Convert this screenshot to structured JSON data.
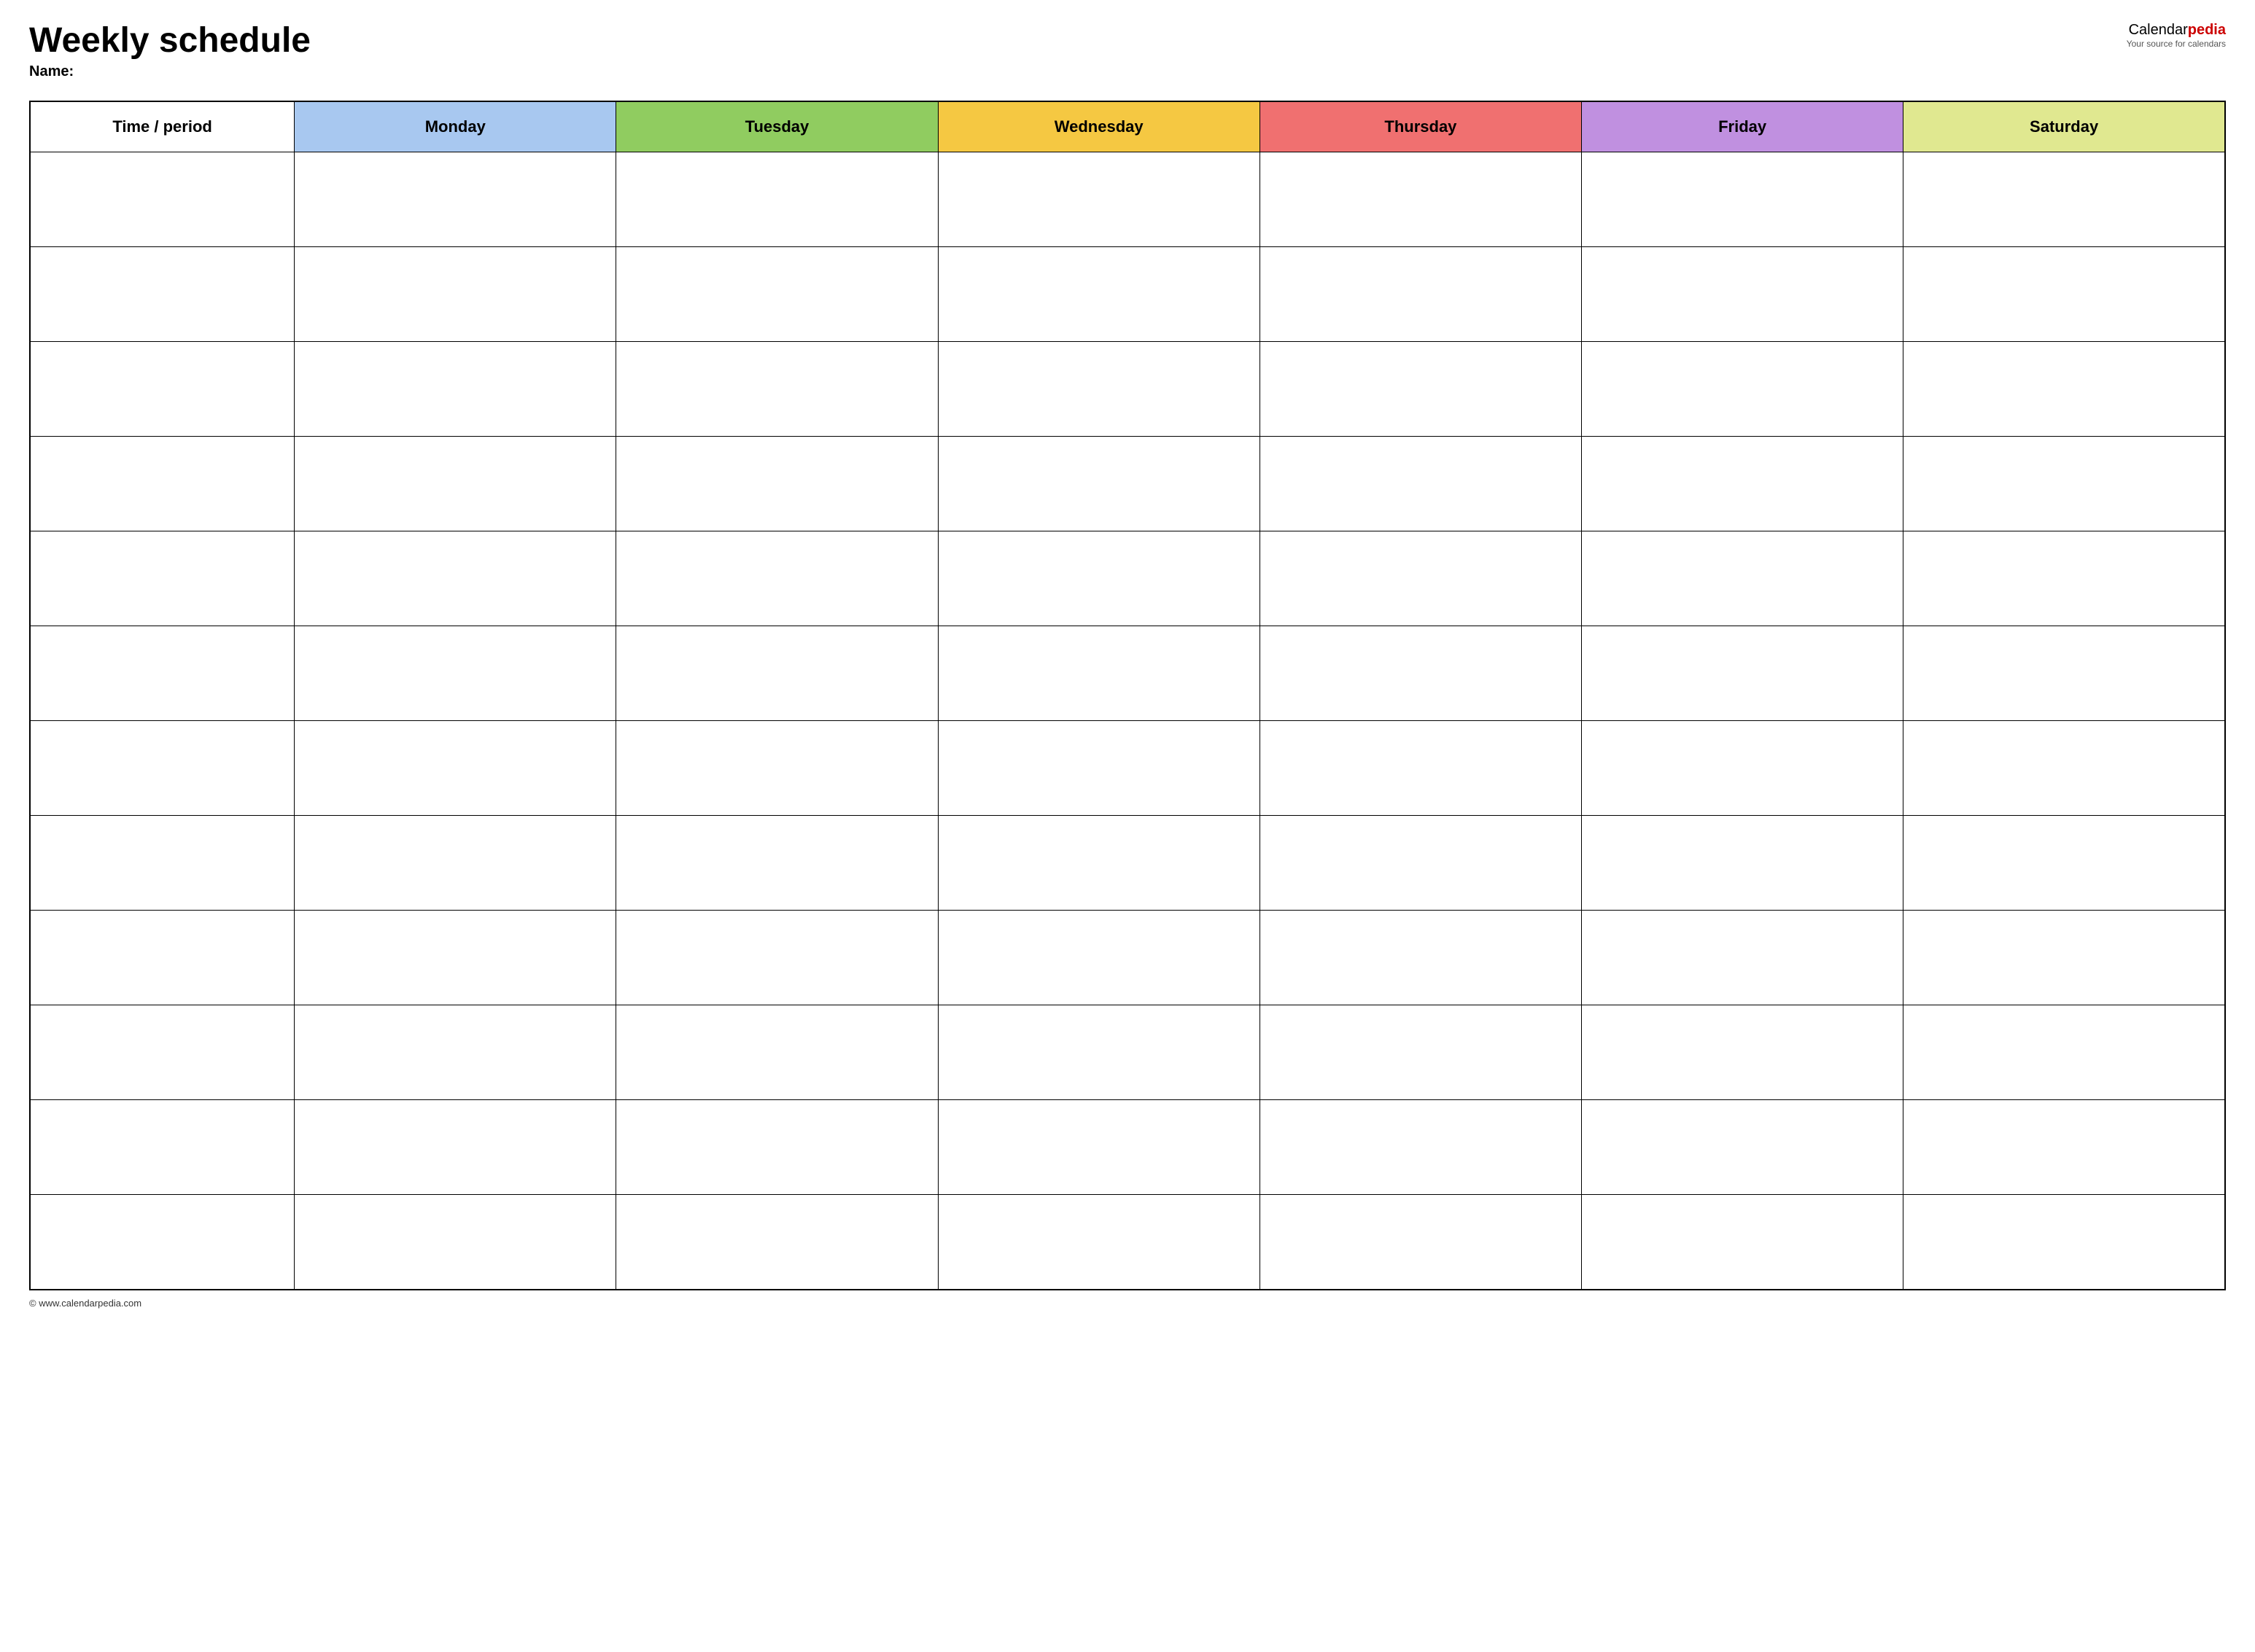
{
  "header": {
    "title": "Weekly schedule",
    "name_label": "Name:",
    "brand": {
      "name_part1": "Calendar",
      "name_part2": "pedia",
      "tagline": "Your source for calendars"
    }
  },
  "table": {
    "columns": [
      {
        "id": "time",
        "label": "Time / period",
        "color": "#ffffff"
      },
      {
        "id": "monday",
        "label": "Monday",
        "color": "#a8c8f0"
      },
      {
        "id": "tuesday",
        "label": "Tuesday",
        "color": "#90cc60"
      },
      {
        "id": "wednesday",
        "label": "Wednesday",
        "color": "#f5c842"
      },
      {
        "id": "thursday",
        "label": "Thursday",
        "color": "#f07070"
      },
      {
        "id": "friday",
        "label": "Friday",
        "color": "#c090e0"
      },
      {
        "id": "saturday",
        "label": "Saturday",
        "color": "#e0e890"
      }
    ],
    "row_count": 12
  },
  "footer": {
    "url": "© www.calendarpedia.com"
  }
}
